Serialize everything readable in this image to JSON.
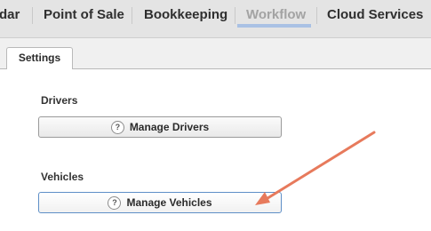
{
  "nav": {
    "items": [
      {
        "label": "dar"
      },
      {
        "label": "Point of Sale"
      },
      {
        "label": "Bookkeeping"
      },
      {
        "label": "Workflow",
        "active": true
      },
      {
        "label": "Cloud Services"
      }
    ]
  },
  "tabs": [
    {
      "label": "Settings"
    }
  ],
  "drivers": {
    "heading": "Drivers",
    "button_label": "Manage Drivers"
  },
  "vehicles": {
    "heading": "Vehicles",
    "button_label": "Manage Vehicles"
  },
  "help_icon_glyph": "?",
  "colors": {
    "nav_active_underline": "#a9c1e4",
    "focus_border": "#5e8fc7",
    "annotation_arrow": "#e77a5c"
  },
  "icons": [
    "help-icon",
    "annotation-arrow"
  ]
}
